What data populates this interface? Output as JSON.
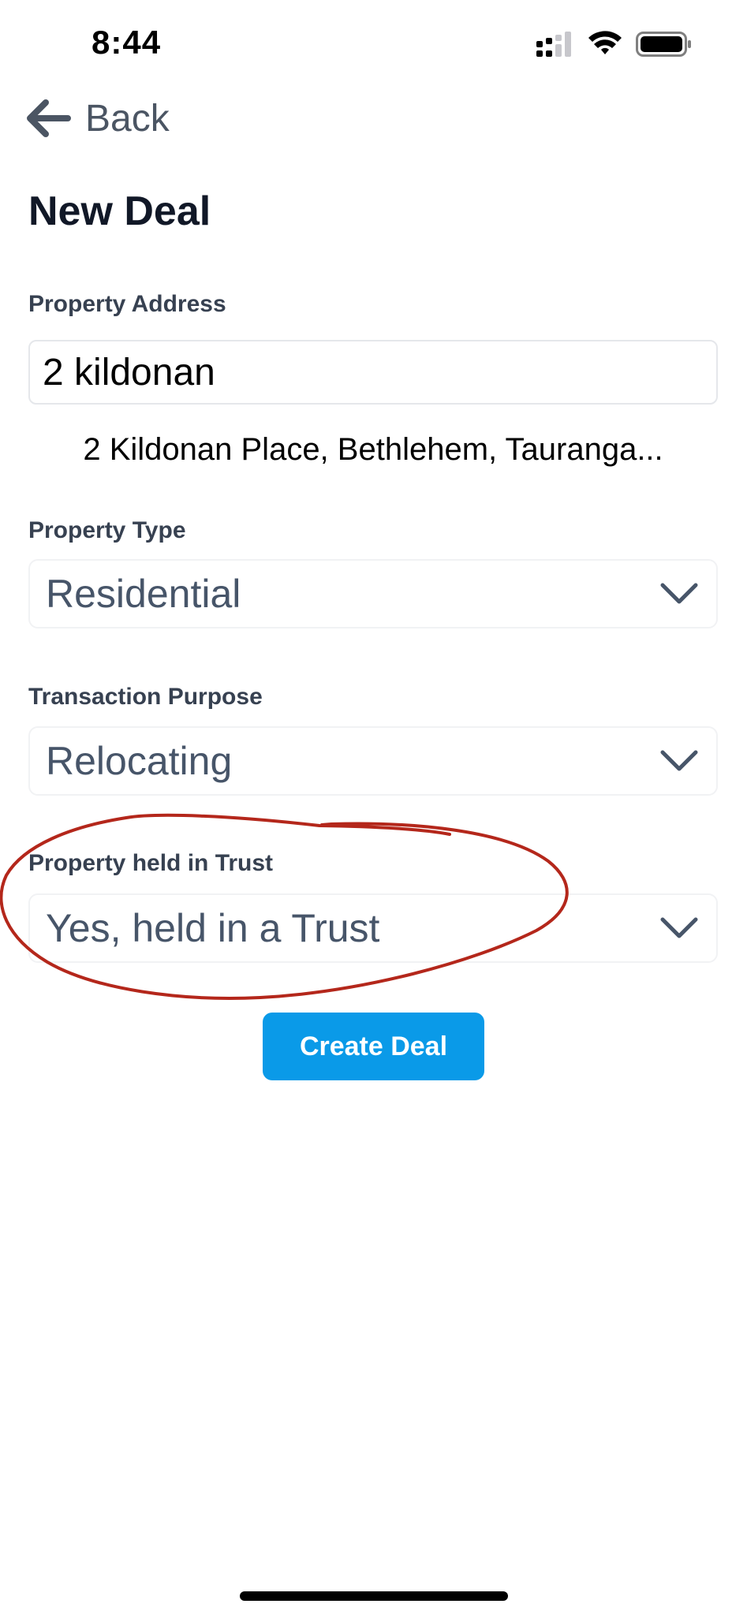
{
  "status_bar": {
    "time": "8:44",
    "icons": [
      "cellular-signal-icon",
      "wifi-icon",
      "battery-icon"
    ]
  },
  "nav": {
    "back_label": "Back",
    "back_icon": "arrow-left-icon"
  },
  "page": {
    "title": "New Deal"
  },
  "form": {
    "address": {
      "label": "Property Address",
      "value": "2 kildonan",
      "suggestion": "2 Kildonan Place, Bethlehem, Tauranga..."
    },
    "property_type": {
      "label": "Property Type",
      "selected": "Residential"
    },
    "transaction_purpose": {
      "label": "Transaction Purpose",
      "selected": "Relocating"
    },
    "held_in_trust": {
      "label": "Property held in Trust",
      "selected": "Yes, held in a Trust"
    },
    "submit_label": "Create Deal"
  },
  "colors": {
    "accent": "#0a9ae8",
    "annotation": "#b4271b",
    "label": "#374151",
    "select_text": "#475569"
  }
}
